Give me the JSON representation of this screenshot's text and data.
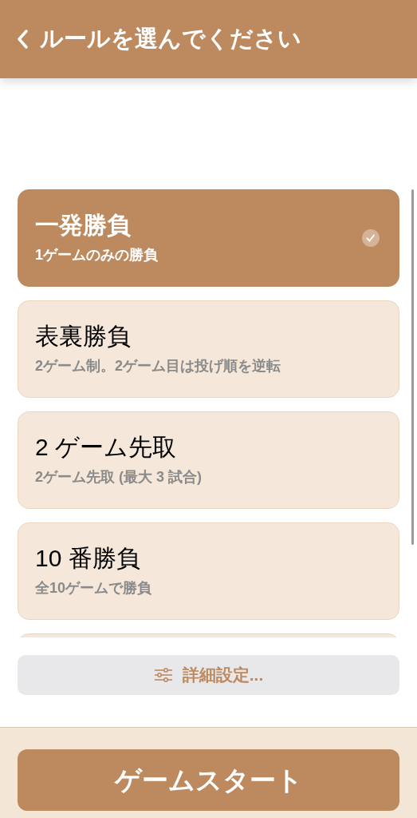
{
  "header": {
    "title": "ルールを選んでください"
  },
  "rules": [
    {
      "title": "一発勝負",
      "subtitle": "1ゲームのみの勝負",
      "selected": true
    },
    {
      "title": "表裏勝負",
      "subtitle": "2ゲーム制。2ゲーム目は投げ順を逆転",
      "selected": false
    },
    {
      "title": "2 ゲーム先取",
      "subtitle": "2ゲーム先取 (最大 3 試合)",
      "selected": false
    },
    {
      "title": "10 番勝負",
      "subtitle": "全10ゲームで勝負",
      "selected": false
    }
  ],
  "details_button": {
    "label": "詳細設定..."
  },
  "start_button": {
    "label": "ゲームスタート"
  }
}
